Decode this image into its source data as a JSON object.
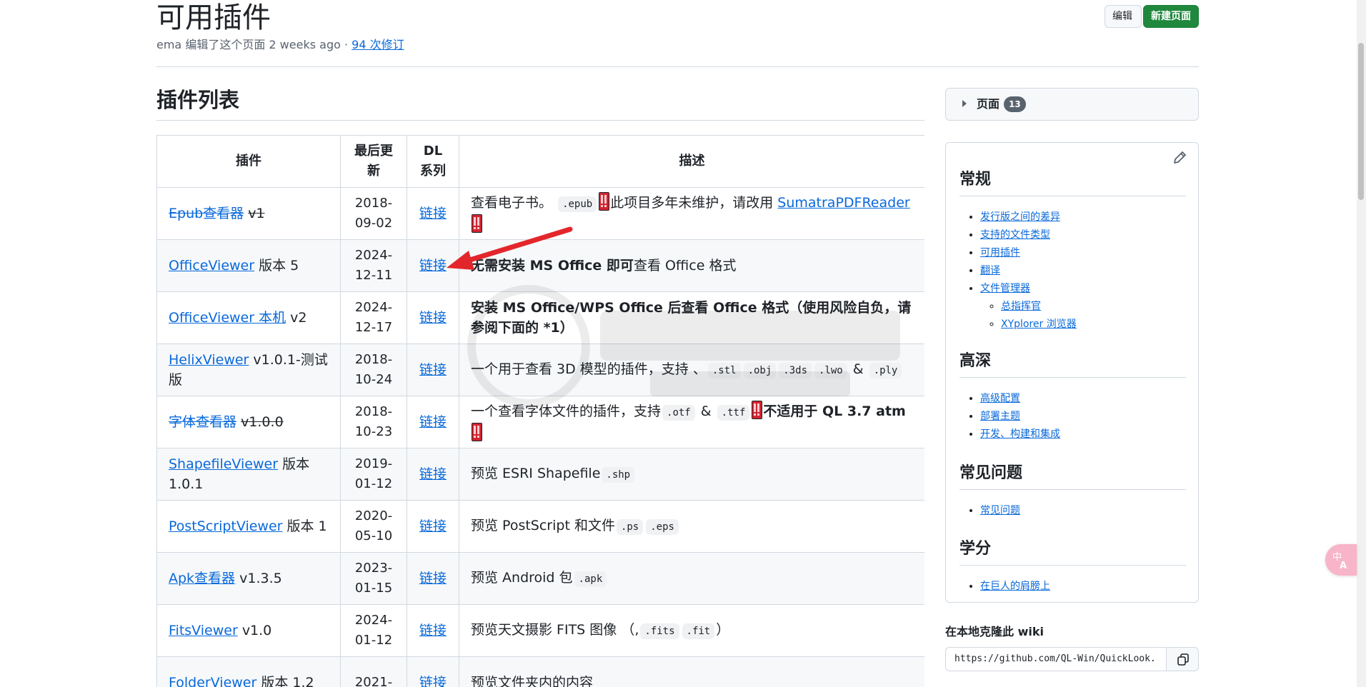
{
  "header": {
    "title": "可用插件",
    "author": "ema",
    "edit_text": "编辑了这个页面 2 weeks ago ·",
    "revisions": "94 次修订",
    "edit_button": "编辑",
    "new_page_button": "新建页面"
  },
  "section_title": "插件列表",
  "table": {
    "headers": [
      "插件",
      "最后更新",
      "DL 系列",
      "描述"
    ],
    "rows": [
      {
        "name": "Epub查看器",
        "version": "v1",
        "strike": true,
        "date": "2018-09-02",
        "dl": "链接",
        "desc_before": "查看电子书。",
        "codes": [
          ".epub"
        ],
        "desc_after": "此项目多年未维护，请改用",
        "link": "SumatraPDFReader"
      },
      {
        "name": "OfficeViewer",
        "version": "版本 5",
        "date": "2024-12-11",
        "dl": "链接",
        "desc_bold": "无需安装 MS Office 即可",
        "desc_after": "查看 Office 格式"
      },
      {
        "name": "OfficeViewer 本机",
        "version": "v2",
        "date": "2024-12-17",
        "dl": "链接",
        "desc_bold": "安装 MS Office/WPS Office 后查看 Office 格式（使用风险自负，请参阅下面的 *1）"
      },
      {
        "name": "HelixViewer",
        "version": "v1.0.1-测试版",
        "date": "2018-10-24",
        "dl": "链接",
        "desc_before": "一个用于查看 3D 模型的插件，支持 、",
        "codes": [
          ".stl",
          ".obj",
          ".3ds",
          ".lwo",
          ".ply"
        ],
        "amp": "&"
      },
      {
        "name": "字体查看器",
        "version": "v1.0.0",
        "strike": true,
        "date": "2018-10-23",
        "dl": "链接",
        "desc_before": "一个查看字体文件的插件，支持",
        "codes": [
          ".otf",
          ".ttf"
        ],
        "amp": "&",
        "desc_bold": "不适用于 QL 3.7 atm"
      },
      {
        "name": "ShapefileViewer",
        "version": "版本 1.0.1",
        "date": "2019-01-12",
        "dl": "链接",
        "desc_before": "预览 ESRI Shapefile",
        "codes": [
          ".shp"
        ]
      },
      {
        "name": "PostScriptViewer",
        "version": "版本 1",
        "date": "2020-05-10",
        "dl": "链接",
        "desc_before": "预览 PostScript 和文件",
        "codes": [
          ".ps",
          ".eps"
        ]
      },
      {
        "name": "Apk查看器",
        "version": "v1.3.5",
        "date": "2023-01-15",
        "dl": "链接",
        "desc_before": "预览 Android 包",
        "codes": [
          ".apk"
        ]
      },
      {
        "name": "FitsViewer",
        "version": "v1.0",
        "date": "2024-01-12",
        "dl": "链接",
        "desc_before": "预览天文摄影 FITS 图像 （,",
        "codes": [
          ".fits",
          ".fit"
        ],
        "desc_after": "）"
      },
      {
        "name": "FolderViewer",
        "version": "版本 1.2",
        "date": "2021-",
        "dl": "链接",
        "desc_before": "预览文件夹内的内容"
      }
    ]
  },
  "sidebar": {
    "pages_label": "页面",
    "pages_count": "13",
    "sections": [
      {
        "title": "常规",
        "items": [
          "发行版之间的差异",
          "支持的文件类型",
          "可用插件",
          "翻译",
          "文件管理器"
        ],
        "sub": [
          "总指挥官",
          "XYplorer 浏览器"
        ]
      },
      {
        "title": "高深",
        "items": [
          "高级配置",
          "部署主题",
          "开发、构建和集成"
        ]
      },
      {
        "title": "常见问题",
        "items": [
          "常见问题"
        ]
      },
      {
        "title": "学分",
        "items": [
          "在巨人的肩膀上"
        ]
      }
    ],
    "clone_title": "在本地克隆此 wiki",
    "clone_url": "https://github.com/QL-Win/QuickLook."
  },
  "colors": {
    "accent": "#0969da",
    "green_button": "#1f883d",
    "arrow": "#e3262b",
    "badge": "#59636e"
  },
  "icons": [
    "pencil-icon",
    "copy-icon",
    "caret-right-icon",
    "exclamation-icon",
    "translate-icon"
  ]
}
